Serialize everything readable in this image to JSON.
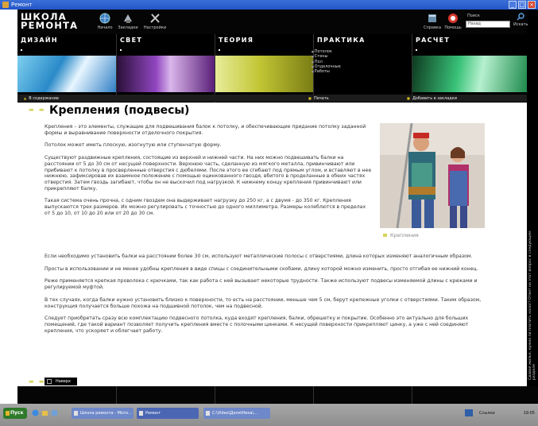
{
  "window": {
    "title": "Ремонт"
  },
  "header": {
    "logo_line1": "ШКОЛА",
    "logo_line2": "РЕМОНТА",
    "tools": [
      {
        "label": "Начало",
        "icon": "globe-icon"
      },
      {
        "label": "Закладки",
        "icon": "bookmark-icon"
      },
      {
        "label": "Настройки",
        "icon": "tools-icon"
      },
      {
        "label": "Справка",
        "icon": "book-icon"
      },
      {
        "label": "Помощь",
        "icon": "lifebuoy-icon"
      }
    ],
    "search": {
      "label": "Поиск",
      "value": "Назад",
      "button": "Искать"
    }
  },
  "categories": [
    {
      "title": "ДИЗАЙН",
      "color": "#3d9bd6"
    },
    {
      "title": "СВЕТ",
      "color": "#8b3db2"
    },
    {
      "title": "ТЕОРИЯ",
      "color": "#b8c530"
    },
    {
      "title": "ПРАКТИКА",
      "color": "#000000"
    },
    {
      "title": "РАСЧЕТ",
      "color": "#35b36a"
    }
  ],
  "practice_items": [
    "Потолок",
    "Стены",
    "Пол",
    "Отделочные",
    "Работы"
  ],
  "navbar": {
    "contents": "В содержание",
    "print": "Печать",
    "bookmark": "Добавить в закладки"
  },
  "article": {
    "title": "Крепления (подвесы)",
    "caption": "Крепления",
    "back": "Наверх",
    "paragraphs_narrow": [
      "Крепления – это элементы, служащие для подвешивания балок к потолку, и обеспечивающие придание потолку заданной формы и выравнивание поверхности отделочного покрытия.",
      "Потолок может иметь плоскую, изогнутую или ступенчатую форму.",
      "Существуют раздвижные крепления, состоящие из верхней и нижней части. На них можно подвешивать балки на расстоянии от 5 до 30 см от несущей поверхности. Верхнюю часть, сделанную из мягкого металла, привинчивают или прибивают к потолку в просверленные отверстия с дюбелями. После этого ее сгибают под прямым углом, и вставляют в нее нижнюю, зафиксировав их взаимное положение с помощью оцинкованного гвоздя, вбитого в проделанные в обеих частях отверстия. Затем гвоздь загибают, чтобы он не выскочил под нагрузкой. К нижнему концу крепления привинчивают или прикрепляют балку.",
      "Такая система очень прочна, с одним гвоздем она выдерживает нагрузку до 250 кг, а с двумя - до 350 кг. Крепления выпускаются трех размеров. Их можно регулировать с точностью до одного миллиметра. Размеры колеблются в пределах от 5 до 10, от 10 до 20 или от 20 до 30 см."
    ],
    "paragraphs_full": [
      "Если необходимо установить балки на расстоянии более 30 см, используют металлические полосы с отверстиями, длина которых изменяют аналогичным образом.",
      "Просты в использовании и не менее удобны крепления в виде спицы с соединительными скобами, длину которой можно изменить, просто отгибая ее нижний конец.",
      "Реже применяется крепкая проволока с крючками, так как работа с ней вызывает некоторые трудности. Также используют подвесы изменяемой длины с крюками и регулируемой муфтой.",
      "В тех случаях, когда балки нужно установить близко к поверхности, то есть на расстоянии, меньше чем 5 см, берут крепежные уголки с отверстиями. Таким образом, конструкция получается больше похожа на подшивной потолок, чем на подвесной.",
      "Следует приобретать сразу всю комплектацию подвесного потолка, куда входят крепления, балки, обрешетку и покрытие. Особенно это актуально для больших помещений, где такой вариант позволяет получить крепления вместе с полочными цинками. К несущей поверхности прикрепляют цинку, а уже с ней соединяют крепления, что ускоряет и облегчает работу."
    ]
  },
  "side_text": "Сдавая жилье, нужно ли платить налог? Ответ на этот вопрос в следующем разделе",
  "taskbar": {
    "start": "Пуск",
    "tasks": [
      "Школа ремонта - Micro...",
      "Ремонт",
      "C:\\Video\\Доля\\Ника\\..."
    ],
    "tray_lang": "Ссылки",
    "clock": "19:05"
  }
}
